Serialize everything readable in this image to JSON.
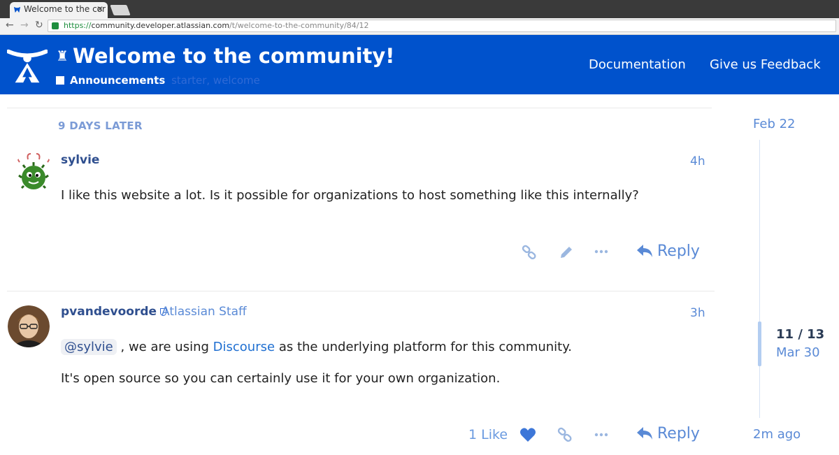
{
  "browser": {
    "tab_title": "Welcome to the cor",
    "url": {
      "scheme": "https://",
      "host": "community.developer.atlassian.com",
      "path": "/t/welcome-to-the-community/84/12"
    }
  },
  "header": {
    "title": "Welcome to the community!",
    "category": "Announcements",
    "tags": "starter, welcome",
    "nav": {
      "documentation": "Documentation",
      "feedback": "Give us Feedback"
    }
  },
  "time_gap": "9 DAYS LATER",
  "posts": [
    {
      "username": "sylvie",
      "time": "4h",
      "text": "I like this website a lot. Is it possible for organizations to host something like this internally?",
      "reply_label": "Reply"
    },
    {
      "username": "pvandevoorde",
      "user_title": "Atlassian Staff",
      "time": "3h",
      "mention": "@sylvie",
      "text_before_link": ", we are using",
      "link_text": "Discourse",
      "text_after_link": "as the underlying platform for this community.",
      "paragraph2": "It's open source so you can certainly use it for your own organization.",
      "like_count": "1 Like",
      "reply_label": "Reply"
    }
  ],
  "timeline": {
    "top_date": "Feb 22",
    "position": "11 / 13",
    "position_date": "Mar 30",
    "bottom_date": "2m ago"
  },
  "colors": {
    "header_bg": "#0052cc",
    "accent": "#5a8ad6",
    "link": "#1f6fd1"
  }
}
